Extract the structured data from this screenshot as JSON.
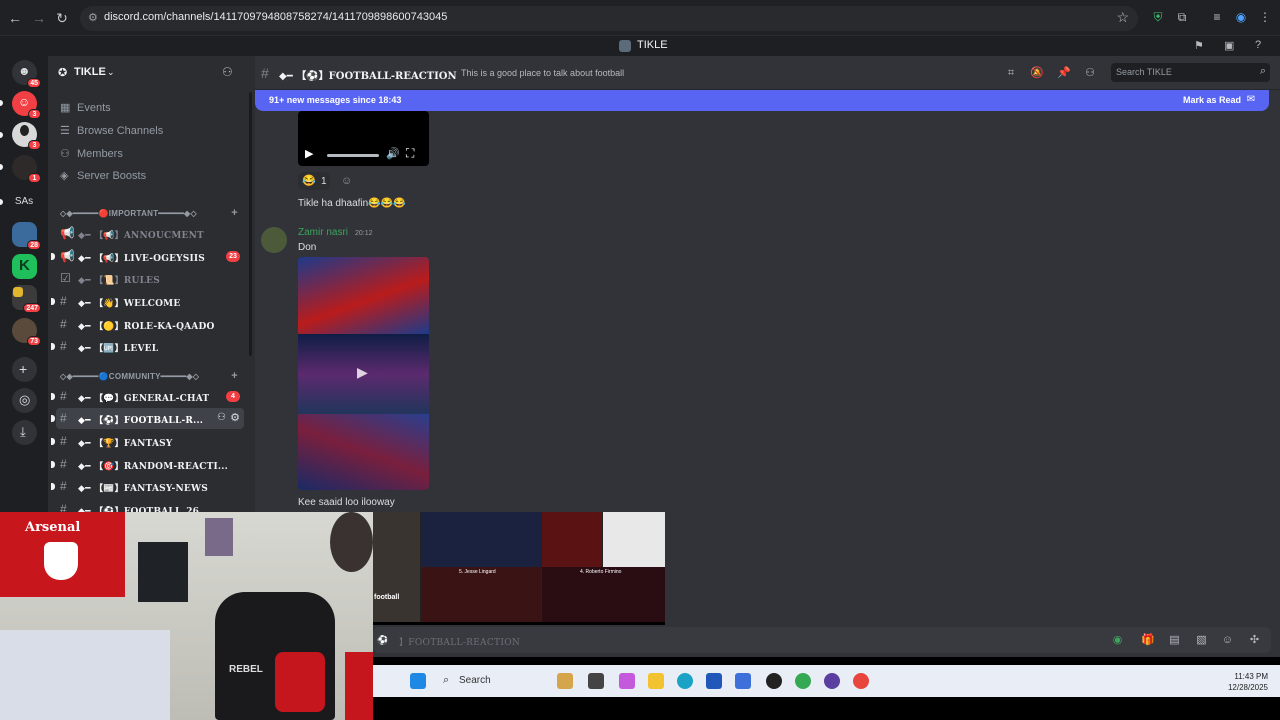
{
  "browser": {
    "url": "discord.com/channels/1411709794808758274/1411709898600743045",
    "back_label": "←",
    "forward_label": "→",
    "reload_label": "↻"
  },
  "app": {
    "title": "TIKLE"
  },
  "server_rail": {
    "badges": [
      "45",
      "3",
      "3",
      "1",
      "28",
      "247",
      "73"
    ],
    "sas_label": "SAs"
  },
  "sidebar": {
    "server_name": "TIKLE",
    "nav": [
      {
        "label": "Events",
        "icon": "calendar-icon"
      },
      {
        "label": "Browse Channels",
        "icon": "browse-icon"
      },
      {
        "label": "Members",
        "icon": "members-icon"
      },
      {
        "label": "Server Boosts",
        "icon": "boost-icon"
      }
    ],
    "categories": [
      {
        "label": "◇◆━━━━━🔴IMPORTANT━━━━━◆◇"
      },
      {
        "label": "◇◆━━━━━🔵COMMUNITY━━━━━◆◇"
      }
    ],
    "channels": [
      {
        "label": "◆━ 【📢】ANNOUCMENT",
        "badge": ""
      },
      {
        "label": "◆━ 【📢】LIVE-OGEYSIIS",
        "badge": "23"
      },
      {
        "label": "◆━ 【📜】RULES",
        "badge": ""
      },
      {
        "label": "◆━ 【👋】WELCOME",
        "badge": ""
      },
      {
        "label": "◆━ 【🟡】ROLE-KA-QAADO",
        "badge": ""
      },
      {
        "label": "◆━ 【🆙】LEVEL",
        "badge": ""
      },
      {
        "label": "◆━ 【💬】GENERAL-CHAT",
        "badge": "4"
      },
      {
        "label": "◆━ 【⚽】FOOTBALL-R...",
        "badge": ""
      },
      {
        "label": "◆━ 【🏆】FANTASY",
        "badge": ""
      },
      {
        "label": "◆━ 【🎯】RANDOM-REACTI...",
        "badge": ""
      },
      {
        "label": "◆━ 【📰】FANTASY-NEWS",
        "badge": ""
      },
      {
        "label": "◆━ 【⚽】FOOTBALL_26",
        "badge": ""
      }
    ]
  },
  "header": {
    "channel_name": "◆━ 【⚽】FOOTBALL-REACTION",
    "topic": "This is a good place to talk about football",
    "search_placeholder": "Search TIKLE"
  },
  "chat": {
    "new_messages": "91+ new messages since 18:43",
    "mark_as_read": "Mark as Read",
    "reaction_emoji": "😂",
    "reaction_count": "1",
    "messages": [
      {
        "text": "Tikle ha dhaafin😂😂😂"
      },
      {
        "author": "Zamir nasri",
        "time": "20:12",
        "text": "Don"
      },
      {
        "text": "Kee saaid loo ilooway"
      }
    ],
    "tile_captions": [
      "5. Jesse Lingard",
      "4. Roberto Firmino",
      "football"
    ]
  },
  "composer": {
    "placeholder": "】FOOTBALL-REACTION"
  },
  "taskbar": {
    "search_label": "Search",
    "time": "11:43 PM",
    "date": "12/28/2025"
  },
  "webcam": {
    "banner_text": "Arsenal",
    "chair_text": "REBEL"
  },
  "colors": {
    "accent": "#5865f2",
    "username": "#3ba55c",
    "badge": "#f23f43"
  }
}
